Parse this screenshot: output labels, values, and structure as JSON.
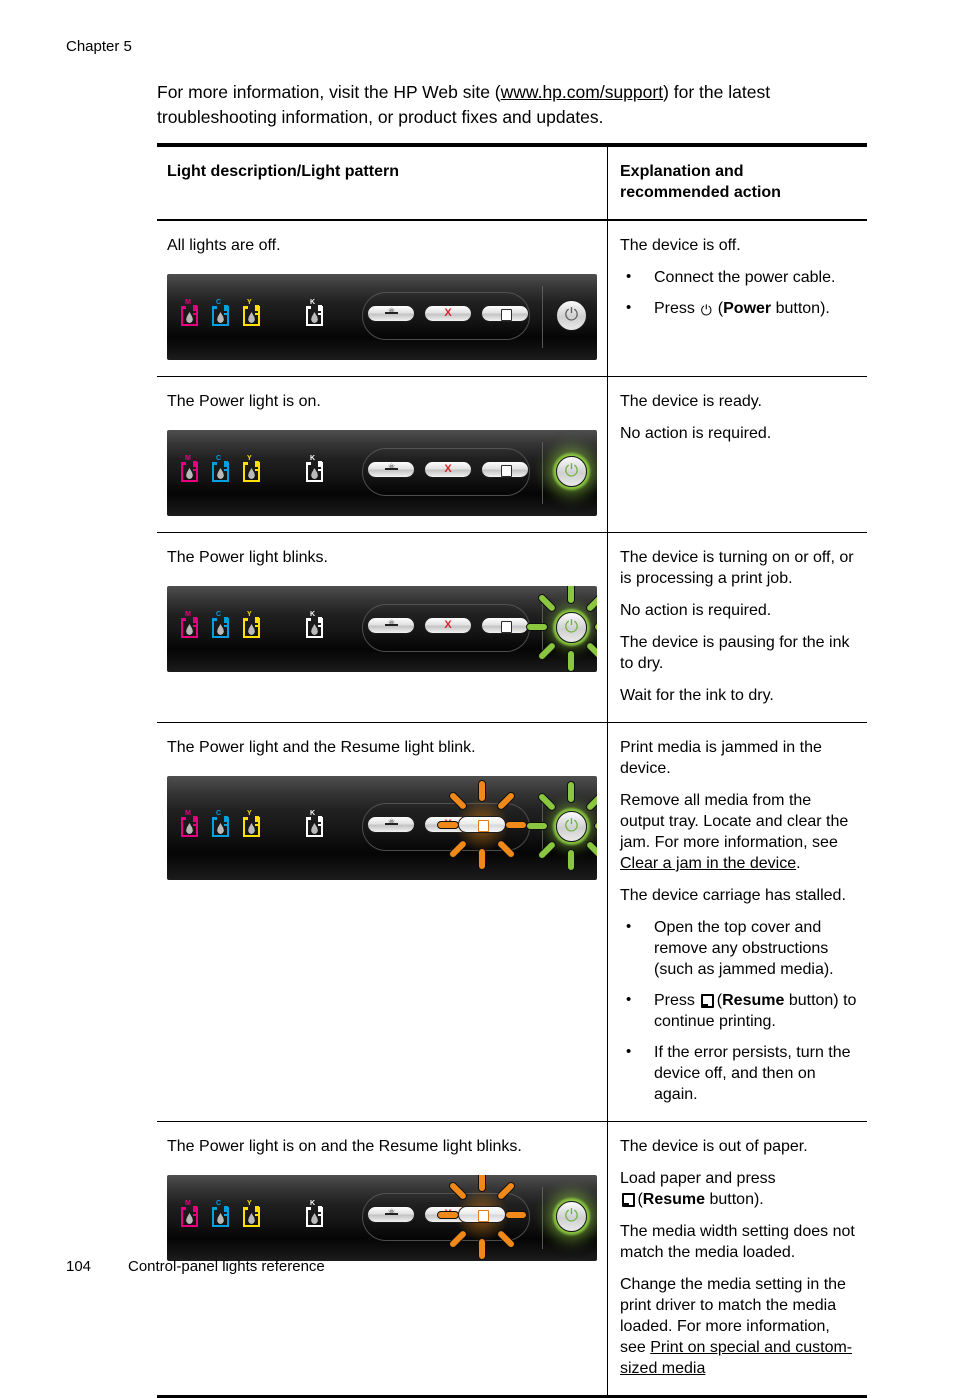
{
  "chapter": "Chapter 5",
  "intro": {
    "before_link": "For more information, visit the HP Web site (",
    "link": "www.hp.com/support",
    "after_link": ") for the latest troubleshooting information, or product fixes and updates."
  },
  "table": {
    "headers": {
      "left": "Light description/Light pattern",
      "right": "Explanation and recommended action"
    },
    "rows": [
      {
        "label": "All lights are off.",
        "panel_state": "all-off",
        "explanation_title": "The device is off.",
        "bullets": [
          {
            "pre": "Connect the power cable.",
            "icon": "",
            "post": ""
          },
          {
            "pre": "Press ",
            "icon": "power-icon",
            "post": " (",
            "bold": "Power",
            "tail": " button)."
          }
        ],
        "paragraphs": []
      },
      {
        "label": "The Power light is on.",
        "panel_state": "power-on",
        "explanation_title": "The device is ready.",
        "bullets": [],
        "paragraphs": [
          "No action is required."
        ]
      },
      {
        "label": "The Power light blinks.",
        "panel_state": "power-blink",
        "explanation_title": "The device is turning on or off, or is processing a print job.",
        "bullets": [],
        "paragraphs": [
          "No action is required.",
          "The device is pausing for the ink to dry.",
          "Wait for the ink to dry."
        ]
      },
      {
        "label": "The Power light and the Resume light blink.",
        "panel_state": "power-blink-resume-blink",
        "explanation_title": "Print media is jammed in the device.",
        "paragraph_with_link": {
          "before": "Remove all media from the output tray. Locate and clear the jam. For more information, see ",
          "link": "Clear a jam in the device",
          "after": "."
        },
        "paragraph_after": "The device carriage has stalled.",
        "bullets": [
          {
            "pre": "Open the top cover and remove any obstructions (such as jammed media).",
            "icon": "",
            "post": ""
          },
          {
            "pre": "Press ",
            "icon": "resume-icon",
            "post": " (",
            "bold": "Resume",
            "tail": " button) to continue printing."
          },
          {
            "pre": "If the error persists, turn the device off, and then on again.",
            "icon": "",
            "post": ""
          }
        ],
        "paragraphs": []
      },
      {
        "label": "The Power light is on and the Resume light blinks.",
        "panel_state": "power-on-resume-blink",
        "explanation_title": "The device is out of paper.",
        "load_paper": {
          "pre": "Load paper and press ",
          "icon": "resume-icon",
          "post": " (",
          "bold": "Resume",
          "tail": " button)."
        },
        "paragraph_mid": "The media width setting does not match the media loaded.",
        "paragraph_with_link": {
          "before": "Change the media setting in the print driver to match the media loaded. For more information, see ",
          "link": "Print on special and custom-sized media",
          "after": ""
        },
        "bullets": [],
        "paragraphs": []
      }
    ]
  },
  "control_panel": {
    "ink_icons": [
      {
        "letter": "M",
        "color": "#e6007e"
      },
      {
        "letter": "C",
        "color": "#00a0e3"
      },
      {
        "letter": "Y",
        "color": "#ffe000"
      },
      {
        "letter": "K",
        "color": "#ffffff"
      }
    ],
    "buttons": [
      {
        "name": "self-size-button",
        "glyph": ""
      },
      {
        "name": "cancel-button",
        "glyph": "X"
      },
      {
        "name": "resume-button",
        "glyph": ""
      }
    ],
    "power_button": {
      "name": "power-button",
      "glyph": "⏻"
    },
    "colors": {
      "power_green": "#8ac63f",
      "resume_orange": "#f0881a",
      "cancel_red": "#d8232a"
    }
  },
  "footer": {
    "page_number": "104",
    "section": "Control-panel lights reference"
  }
}
